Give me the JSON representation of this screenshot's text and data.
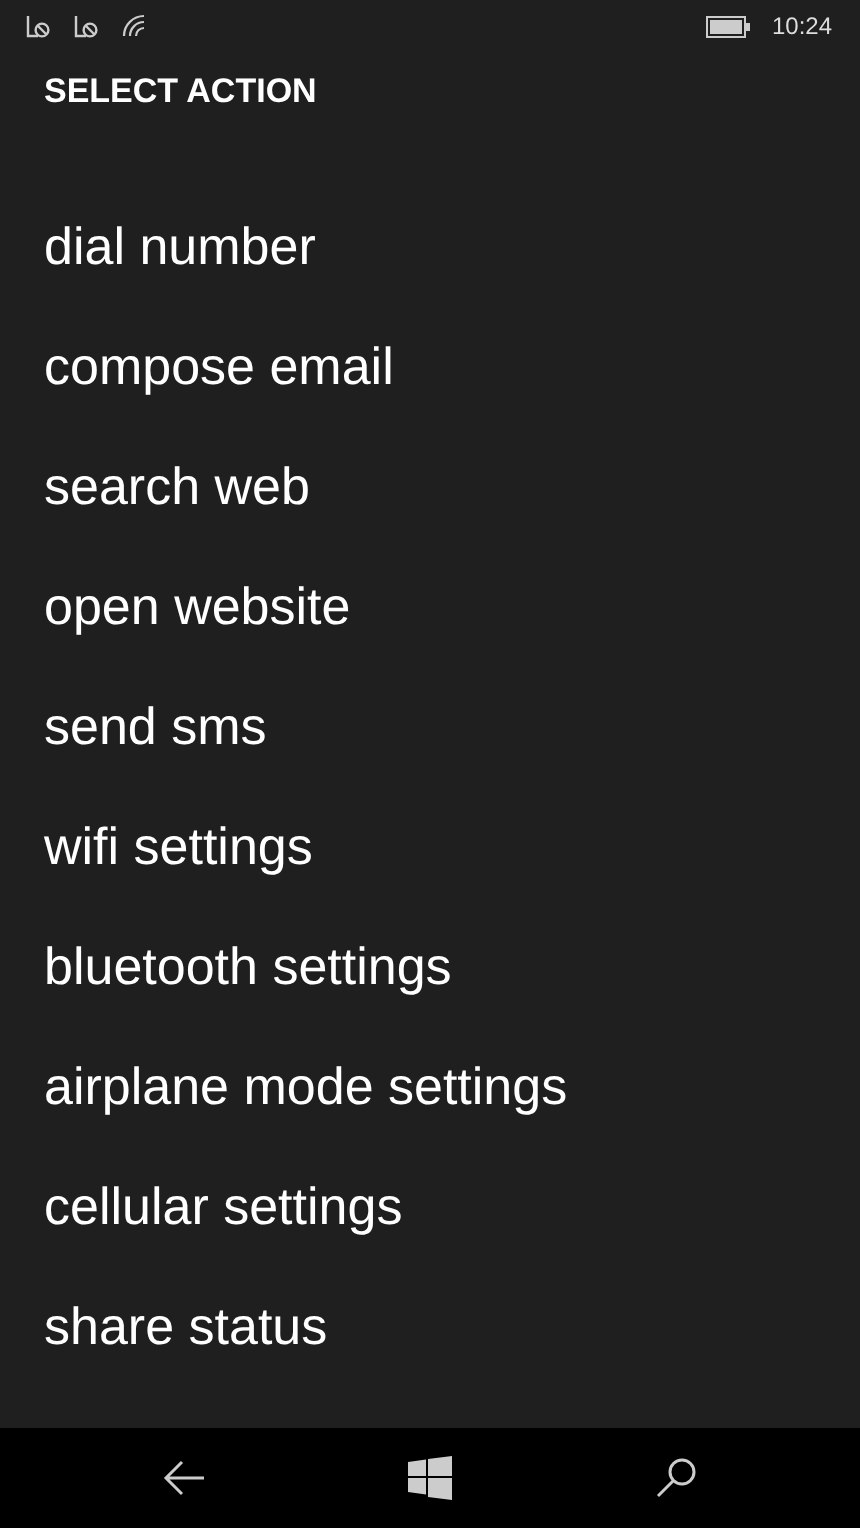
{
  "status_bar": {
    "time": "10:24"
  },
  "title": "SELECT ACTION",
  "actions": [
    {
      "label": "dial number"
    },
    {
      "label": "compose email"
    },
    {
      "label": "search web"
    },
    {
      "label": "open website"
    },
    {
      "label": "send sms"
    },
    {
      "label": "wifi settings"
    },
    {
      "label": "bluetooth settings"
    },
    {
      "label": "airplane mode settings"
    },
    {
      "label": "cellular settings"
    },
    {
      "label": "share status"
    }
  ]
}
